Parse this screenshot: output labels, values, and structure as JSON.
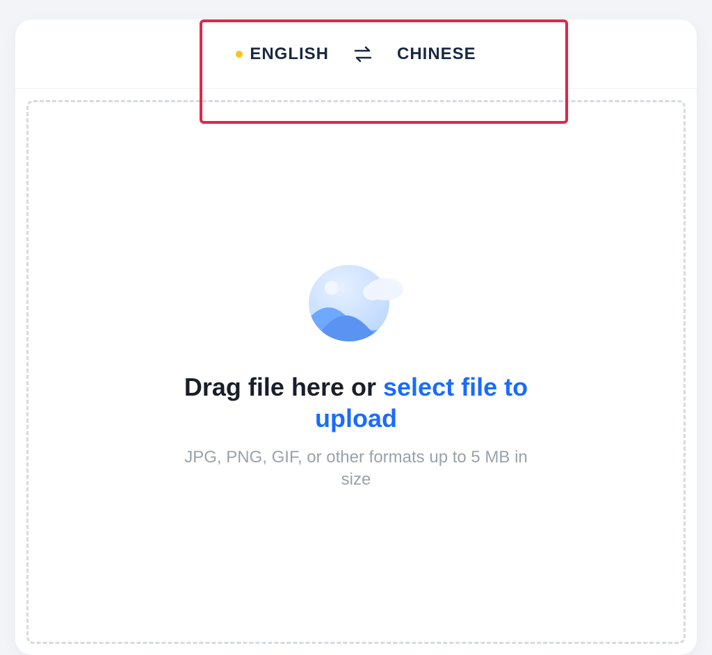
{
  "lang": {
    "source": "ENGLISH",
    "target": "CHINESE"
  },
  "upload": {
    "drag_text": "Drag file here or ",
    "select_link": "select file to upload",
    "subtitle": "JPG, PNG, GIF, or other formats up to 5 MB in size"
  }
}
